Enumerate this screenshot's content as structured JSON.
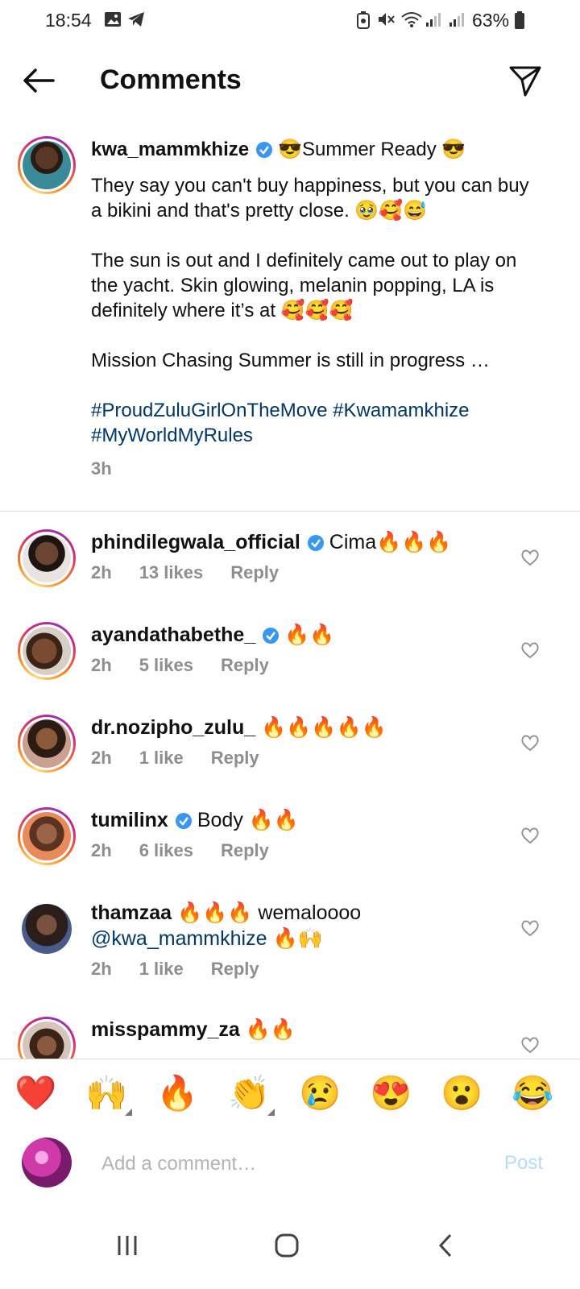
{
  "status_bar": {
    "time": "18:54",
    "battery": "63%",
    "icons": [
      "gallery-icon",
      "telegram-icon",
      "data-saver-icon",
      "mute-icon",
      "wifi-icon",
      "signal-icon",
      "signal-icon",
      "battery-icon"
    ]
  },
  "header": {
    "title": "Comments",
    "back_icon": "arrow-left-icon",
    "share_icon": "paper-plane-icon"
  },
  "caption": {
    "username": "kwa_mammkhize",
    "verified": true,
    "title_text": "😎Summer Ready 😎",
    "paragraph1": "They say you can't buy happiness, but you can buy a bikini and that's pretty close. 🥹🥰😅",
    "paragraph2": "The sun is out and I definitely came out to play on the yacht. Skin glowing, melanin popping, LA is definitely where it’s at 🥰🥰🥰",
    "paragraph3": "Mission Chasing Summer is still in progress …",
    "hashtags": "#ProudZuluGirlOnTheMove #Kwamamkhize #MyWorldMyRules",
    "time": "3h"
  },
  "comments": [
    {
      "username": "phindilegwala_official",
      "verified": true,
      "text": "Cima🔥🔥🔥",
      "time": "2h",
      "likes": "13 likes",
      "reply": "Reply"
    },
    {
      "username": "ayandathabethe_",
      "verified": true,
      "text": "🔥🔥",
      "time": "2h",
      "likes": "5 likes",
      "reply": "Reply"
    },
    {
      "username": "dr.nozipho_zulu_",
      "verified": false,
      "text": "🔥🔥🔥🔥🔥",
      "time": "2h",
      "likes": "1 like",
      "reply": "Reply"
    },
    {
      "username": "tumilinx",
      "verified": true,
      "text": "Body 🔥🔥",
      "time": "2h",
      "likes": "6 likes",
      "reply": "Reply"
    },
    {
      "username": "thamzaa",
      "verified": false,
      "text": "🔥🔥🔥 wemaloooo",
      "mention": "@kwa_mammkhize",
      "mention_tail": "🔥🙌",
      "time": "2h",
      "likes": "1 like",
      "reply": "Reply"
    },
    {
      "username": "misspammy_za",
      "verified": false,
      "text": "🔥🔥"
    }
  ],
  "emoji_bar": [
    "❤️",
    "🙌",
    "🔥",
    "👏",
    "😢",
    "😍",
    "😮",
    "😂"
  ],
  "comment_bar": {
    "placeholder": "Add a comment…",
    "post_label": "Post"
  },
  "colors": {
    "accent": "#0095f6",
    "verified": "#3897f0",
    "hashtag": "#00376b",
    "meta_gray": "#8e8e8e",
    "post_disabled": "#b3dbff"
  },
  "nav_icons": [
    "recent-apps-icon",
    "home-icon",
    "back-icon"
  ]
}
